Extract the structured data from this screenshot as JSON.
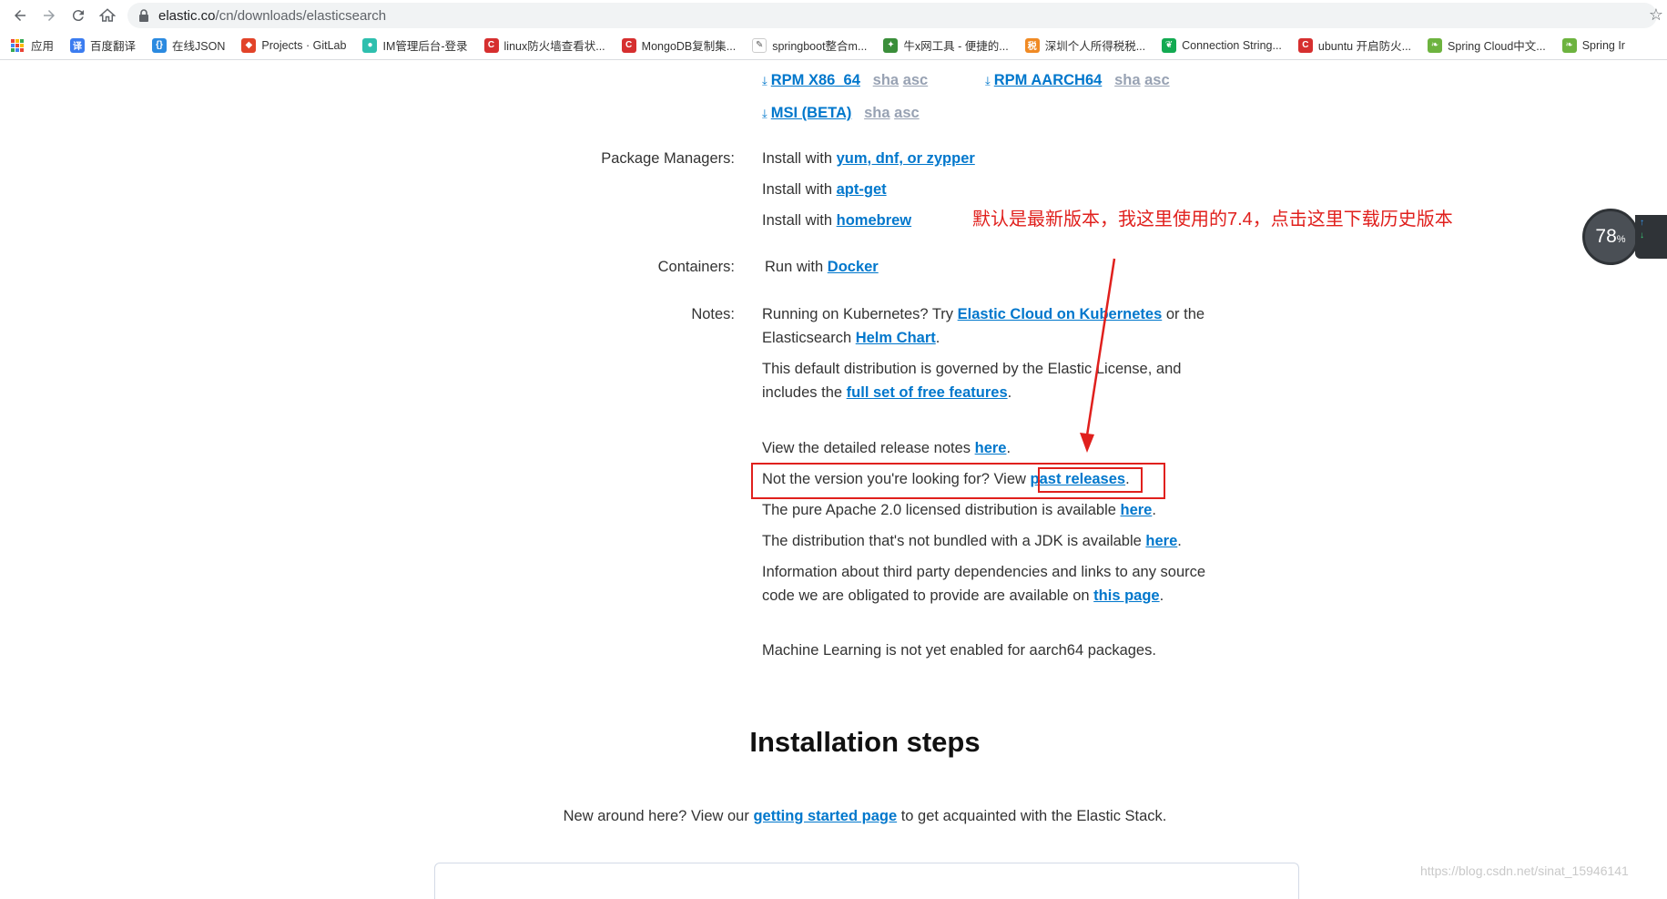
{
  "browser": {
    "url_host": "elastic.co",
    "url_path": "/cn/downloads/elasticsearch",
    "bookmarks": [
      {
        "label": "应用",
        "color": "#4285f4"
      },
      {
        "label": "百度翻译",
        "color": "#3b7cf0"
      },
      {
        "label": "在线JSON",
        "color": "#2b8ae0"
      },
      {
        "label": "Projects · GitLab",
        "color": "#e24329"
      },
      {
        "label": "IM管理后台-登录",
        "color": "#2ebfae"
      },
      {
        "label": "linux防火墙查看状...",
        "color": "#d62f2f"
      },
      {
        "label": "MongoDB复制集...",
        "color": "#d62f2f"
      },
      {
        "label": "springboot整合m...",
        "color": "#555555"
      },
      {
        "label": "牛x网工具 - 便捷的...",
        "color": "#3a8e3a"
      },
      {
        "label": "深圳个人所得税税...",
        "color": "#f08a24"
      },
      {
        "label": "Connection String...",
        "color": "#13aa52"
      },
      {
        "label": "ubuntu 开启防火...",
        "color": "#d62f2f"
      },
      {
        "label": "Spring Cloud中文...",
        "color": "#6db33f"
      },
      {
        "label": "Spring Ir",
        "color": "#6db33f"
      }
    ]
  },
  "downloads": {
    "rpm_x86": "RPM X86_64",
    "rpm_aarch": "RPM AARCH64",
    "msi": "MSI (BETA)",
    "sha": "sha",
    "asc": "asc"
  },
  "package_managers": {
    "label": "Package Managers:",
    "install_prefix": "Install with ",
    "yum_link": "yum, dnf, or zypper",
    "apt_link": "apt-get",
    "brew_link": "homebrew"
  },
  "containers": {
    "label": "Containers:",
    "prefix": "Run with ",
    "docker_link": "Docker"
  },
  "notes": {
    "label": "Notes:",
    "k8s_prefix": "Running on Kubernetes? Try ",
    "k8s_link": "Elastic Cloud on Kubernetes",
    "k8s_mid": " or the Elasticsearch ",
    "helm_link": "Helm Chart",
    "license_text": "This default distribution is governed by the Elastic License, and includes the ",
    "free_features_link": "full set of free features",
    "release_notes_prefix": "View the detailed release notes ",
    "here": "here",
    "past_prefix": "Not the version you're looking for? View ",
    "past_link": "past releases",
    "apache_prefix": "The pure Apache 2.0 licensed distribution is available ",
    "nojdk_prefix": "The distribution that's not bundled with a JDK is available ",
    "thirdparty_prefix": "Information about third party dependencies and links to any source code we are obligated to provide are available on ",
    "this_page_link": "this page",
    "ml_text": "Machine Learning is not yet enabled for aarch64 packages."
  },
  "installation": {
    "heading": "Installation steps",
    "intro_prefix": "New around here? View our ",
    "getting_started_link": "getting started page",
    "intro_suffix": " to get acquainted with the Elastic Stack."
  },
  "annotation_text": "默认是最新版本，我这里使用的7.4，点击这里下载历史版本",
  "speed_widget": {
    "value": "78",
    "unit": "%"
  },
  "watermark": "https://blog.csdn.net/sinat_15946141",
  "colors": {
    "link": "#0077cc",
    "annotation": "#e0201d"
  }
}
